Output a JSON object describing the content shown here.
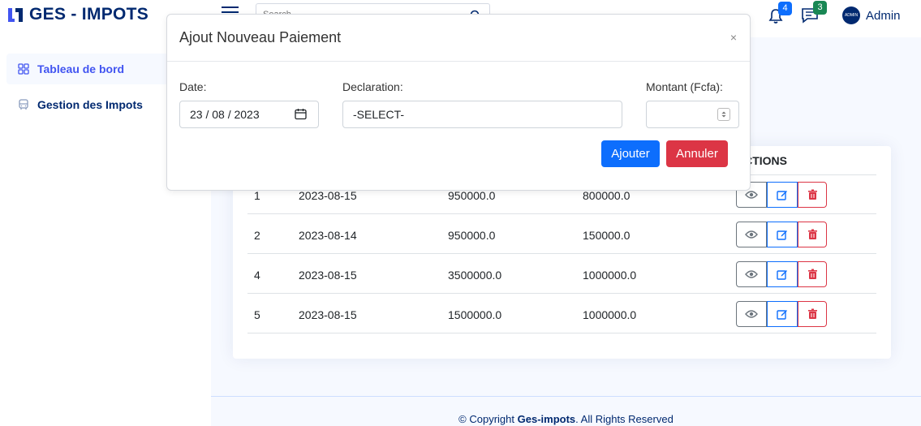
{
  "header": {
    "brand": "GES - IMPOTS",
    "search_placeholder": "Search",
    "notifications_count": "4",
    "messages_count": "3",
    "avatar_text": "ADMIN",
    "user_name": "Admin"
  },
  "sidebar": {
    "items": [
      {
        "label": "Tableau de bord",
        "icon": "grid-icon"
      },
      {
        "label": "Gestion des Impots",
        "icon": "bus-icon"
      }
    ]
  },
  "table": {
    "actions_header": "ACTIONS",
    "rows": [
      {
        "id": "1",
        "date": "2023-08-15",
        "amount": "950000.0",
        "paid": "800000.0"
      },
      {
        "id": "2",
        "date": "2023-08-14",
        "amount": "950000.0",
        "paid": "150000.0"
      },
      {
        "id": "4",
        "date": "2023-08-15",
        "amount": "3500000.0",
        "paid": "1000000.0"
      },
      {
        "id": "5",
        "date": "2023-08-15",
        "amount": "1500000.0",
        "paid": "1000000.0"
      }
    ]
  },
  "footer": {
    "prefix": "© Copyright",
    "brand": "Ges-impots",
    "suffix": ". All Rights Reserved"
  },
  "modal": {
    "title": "Ajout Nouveau Paiement",
    "close": "×",
    "date_label": "Date:",
    "date_value": "23 / 08 / 2023",
    "declaration_label": "Declaration:",
    "declaration_value": "-SELECT-",
    "montant_label": "Montant (Fcfa):",
    "montant_value": "",
    "submit_label": "Ajouter",
    "cancel_label": "Annuler"
  },
  "colors": {
    "brand": "#012970",
    "accent": "#4154f1",
    "primary": "#0d6efd",
    "danger": "#dc3545",
    "success": "#198754"
  }
}
